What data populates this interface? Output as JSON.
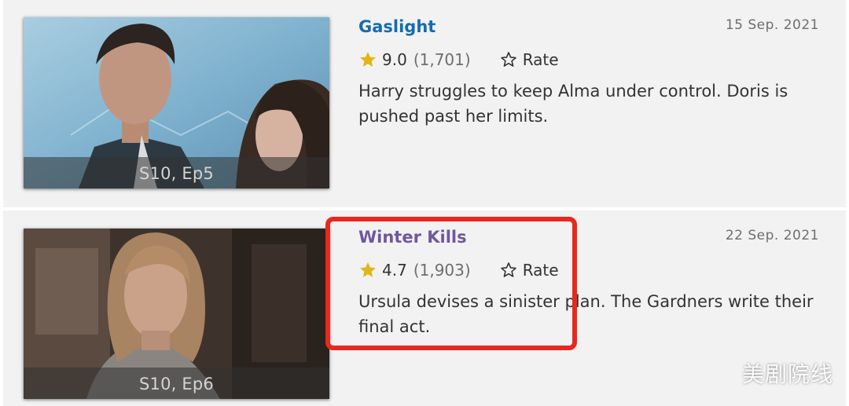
{
  "episodes": [
    {
      "title": "Gaslight",
      "date": "15 Sep. 2021",
      "rating": "9.0",
      "votes": "(1,701)",
      "rate_label": "Rate",
      "plot": "Harry struggles to keep Alma under control. Doris is pushed past her limits.",
      "episode_label": "S10, Ep5",
      "title_color": "#136cb2"
    },
    {
      "title": "Winter Kills",
      "date": "22 Sep. 2021",
      "rating": "4.7",
      "votes": "(1,903)",
      "rate_label": "Rate",
      "plot": "Ursula devises a sinister plan. The Gardners write their final act.",
      "episode_label": "S10, Ep6",
      "title_color": "#70579d"
    }
  ],
  "icons": {
    "rating_star": "star-filled-icon",
    "rate_star": "star-outline-icon",
    "star_color": "#e2b616"
  },
  "highlight": {
    "color": "#e8281f"
  },
  "watermark": "美剧院线"
}
